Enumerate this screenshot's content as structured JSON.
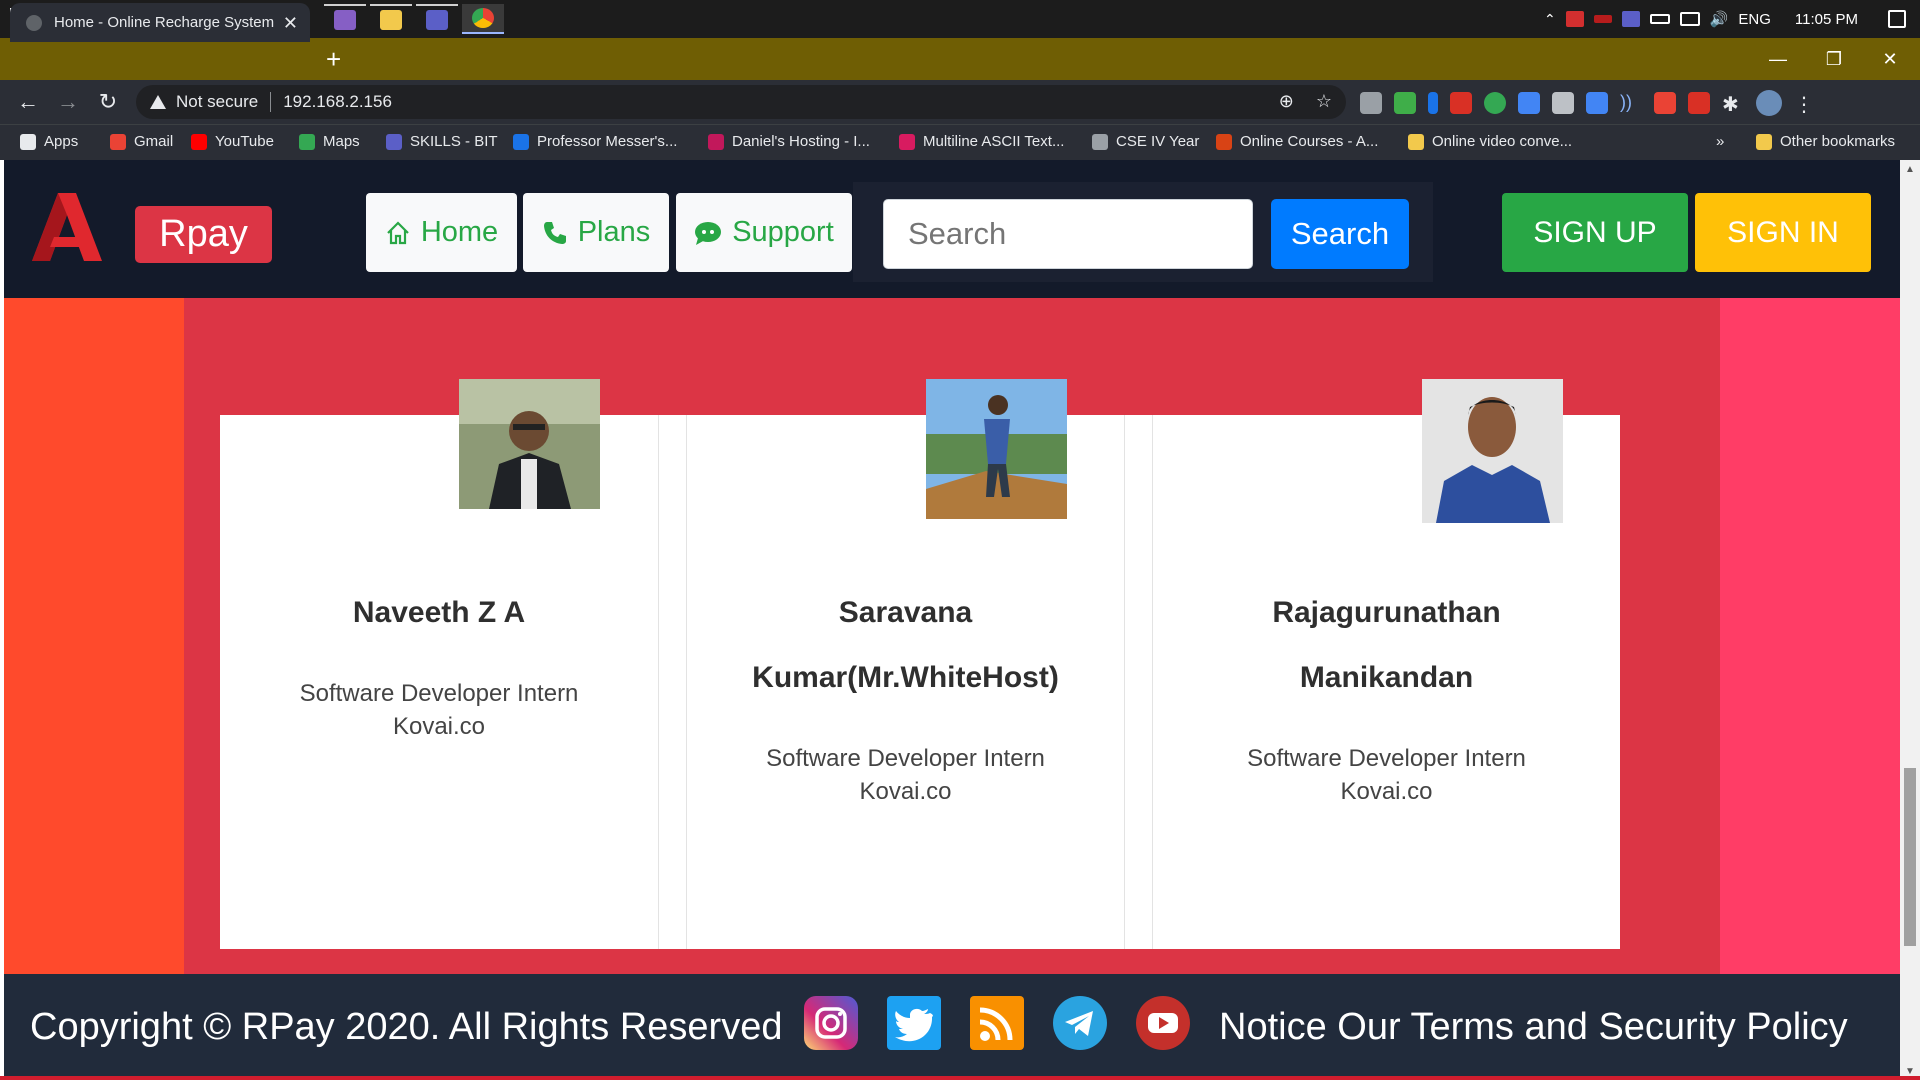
{
  "taskbar": {
    "tray": {
      "language": "ENG",
      "time": "11:05 PM"
    }
  },
  "browser": {
    "tab_title": "Home - Online Recharge System",
    "security_label": "Not secure",
    "url": "192.168.2.156",
    "bookmarks": [
      {
        "label": "Apps",
        "icon": "apps-grid-icon"
      },
      {
        "label": "Gmail",
        "icon": "gmail-icon"
      },
      {
        "label": "YouTube",
        "icon": "youtube-icon"
      },
      {
        "label": "Maps",
        "icon": "maps-icon"
      },
      {
        "label": "SKILLS - BIT",
        "icon": "skills-icon"
      },
      {
        "label": "Professor Messer's...",
        "icon": "professor-messer-icon"
      },
      {
        "label": "Daniel's Hosting - I...",
        "icon": "raspberry-icon"
      },
      {
        "label": "Multiline ASCII Text...",
        "icon": "ascii-icon"
      },
      {
        "label": "CSE IV Year",
        "icon": "dot-icon"
      },
      {
        "label": "Online Courses - A...",
        "icon": "courses-icon"
      },
      {
        "label": "Online video conve...",
        "icon": "video-convert-icon"
      }
    ],
    "bookmarks_overflow": "»",
    "other_bookmarks": "Other bookmarks"
  },
  "site": {
    "brand": "Rpay",
    "nav": {
      "home": "Home",
      "plans": "Plans",
      "support": "Support"
    },
    "search_placeholder": "Search",
    "search_button": "Search",
    "signup": "SIGN UP",
    "signin": "SIGN IN",
    "team": [
      {
        "name_line1": "Naveeth Z A",
        "name_line2": "",
        "role": "Software Developer Intern",
        "company": "Kovai.co"
      },
      {
        "name_line1": "Saravana",
        "name_line2": "Kumar(Mr.WhiteHost)",
        "role": "Software Developer Intern",
        "company": "Kovai.co"
      },
      {
        "name_line1": "Rajagurunathan",
        "name_line2": "Manikandan",
        "role": "Software Developer Intern",
        "company": "Kovai.co"
      }
    ],
    "footer": {
      "copyright": "Copyright © RPay 2020. All Rights Reserved",
      "policy": "Notice Our Terms and Security Policy"
    }
  },
  "colors": {
    "navbar": "#131a2a",
    "brand_red": "#dc3545",
    "band_left": "#ff4a2c",
    "band_right": "#ff3d66",
    "success": "#28a745",
    "warning": "#ffc107",
    "primary": "#007bff",
    "footer": "#212b3b"
  }
}
